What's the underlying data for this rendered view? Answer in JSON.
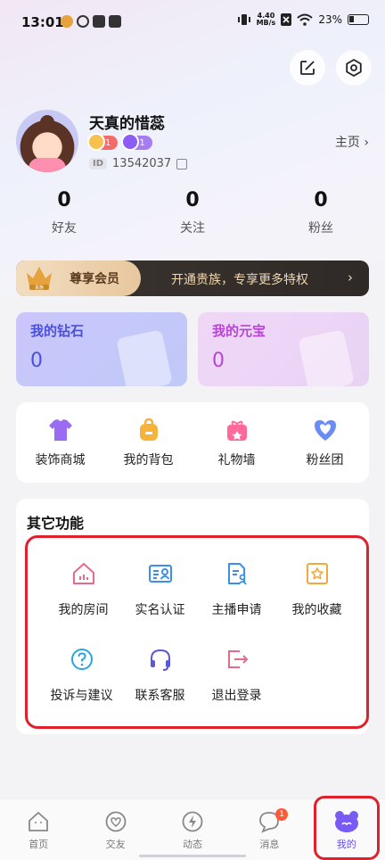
{
  "status_bar": {
    "time": "13:01",
    "net_speed_value": "4.40",
    "net_speed_unit": "MB/s",
    "battery": "23%"
  },
  "header": {
    "edit_icon": "edit-icon",
    "settings_icon": "gear-icon"
  },
  "profile": {
    "nickname": "天真的惜蕊",
    "wealth_level": "1",
    "charm_level": "1",
    "id_tag": "ID",
    "user_id": "13542037",
    "homepage_label": "主页",
    "homepage_arrow": "›"
  },
  "stats": [
    {
      "value": "0",
      "label": "好友"
    },
    {
      "value": "0",
      "label": "关注"
    },
    {
      "value": "0",
      "label": "粉丝"
    }
  ],
  "vip": {
    "badge_text": "贵族",
    "label": "尊享会员",
    "promo": "开通贵族，专享更多特权",
    "arrow": "›"
  },
  "wallet": {
    "diamond": {
      "title": "我的钻石",
      "value": "0"
    },
    "ingot": {
      "title": "我的元宝",
      "value": "0"
    }
  },
  "quick": [
    {
      "label": "装饰商城",
      "icon": "shirt-icon",
      "color": "#9b6bf2"
    },
    {
      "label": "我的背包",
      "icon": "backpack-icon",
      "color": "#f5b33c"
    },
    {
      "label": "礼物墙",
      "icon": "gift-icon",
      "color": "#ff6a9a"
    },
    {
      "label": "粉丝团",
      "icon": "heart-badge-icon",
      "color": "#6a8cf6"
    }
  ],
  "other": {
    "title": "其它功能",
    "items": [
      {
        "label": "我的房间",
        "icon": "house-icon",
        "color": "#e86a8a"
      },
      {
        "label": "实名认证",
        "icon": "id-card-icon",
        "color": "#3a8fe8"
      },
      {
        "label": "主播申请",
        "icon": "document-user-icon",
        "color": "#3a8fe8"
      },
      {
        "label": "我的收藏",
        "icon": "star-box-icon",
        "color": "#f2a93b"
      },
      {
        "label": "投诉与建议",
        "icon": "question-circle-icon",
        "color": "#2aa4e0"
      },
      {
        "label": "联系客服",
        "icon": "headset-icon",
        "color": "#5a5ad8"
      },
      {
        "label": "退出登录",
        "icon": "logout-icon",
        "color": "#e86a8a"
      }
    ]
  },
  "nav": [
    {
      "label": "首页",
      "icon": "home-icon"
    },
    {
      "label": "交友",
      "icon": "heart-circle-icon"
    },
    {
      "label": "动态",
      "icon": "lightning-icon"
    },
    {
      "label": "消息",
      "icon": "chat-bubble-icon",
      "badge": "1"
    },
    {
      "label": "我的",
      "icon": "profile-mascot-icon",
      "active": true
    }
  ]
}
